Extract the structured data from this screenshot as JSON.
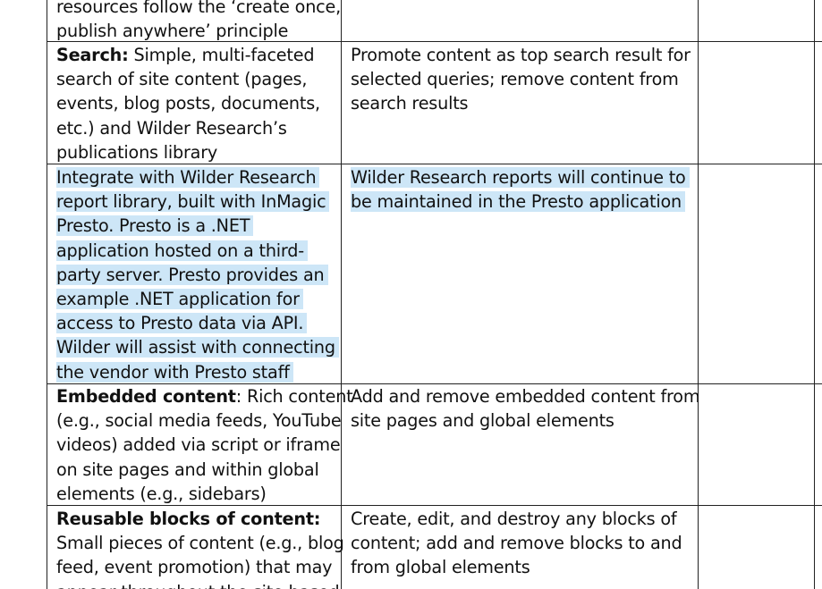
{
  "rows": [
    {
      "requirement": {
        "lines": [
          "resources follow the ‘create once,",
          "publish anywhere’ principle"
        ]
      },
      "admin": {
        "lines": []
      }
    },
    {
      "requirement": {
        "label": "Search:",
        "first_rest": " Simple, multi-faceted",
        "lines": [
          "search of site content (pages,",
          "events, blog posts, documents,",
          "etc.) and Wilder Research’s",
          "publications library"
        ]
      },
      "admin": {
        "lines": [
          "Promote content as top search result for",
          "selected queries; remove content from",
          "search results"
        ]
      }
    },
    {
      "requirement": {
        "lines": [
          "Integrate with Wilder Research",
          "report library, built with InMagic",
          "Presto. Presto is a .NET",
          "application hosted on a third-",
          "party server. Presto provides an",
          "example .NET application for",
          "access to Presto data via API.",
          "Wilder will assist with connecting",
          "the vendor with Presto staff"
        ]
      },
      "admin": {
        "lines": [
          "Wilder Research reports will continue to",
          "be maintained in the Presto application"
        ]
      }
    },
    {
      "requirement": {
        "label": "Embedded content",
        "first_rest": ": Rich content",
        "lines": [
          "(e.g., social media feeds, YouTube",
          "videos) added via script or iframe",
          "on site pages and within global",
          "elements (e.g., sidebars)"
        ]
      },
      "admin": {
        "lines": [
          "Add and remove embedded content from",
          "site pages and global elements"
        ]
      }
    },
    {
      "requirement": {
        "label": "Reusable blocks of content:",
        "lines": [
          "Small pieces of content (e.g., blog",
          "feed, event promotion) that may",
          "appear throughout the site based"
        ]
      },
      "admin": {
        "lines": [
          "Create, edit, and destroy any blocks of",
          "content; add and remove blocks to and",
          "from global elements"
        ]
      }
    }
  ]
}
